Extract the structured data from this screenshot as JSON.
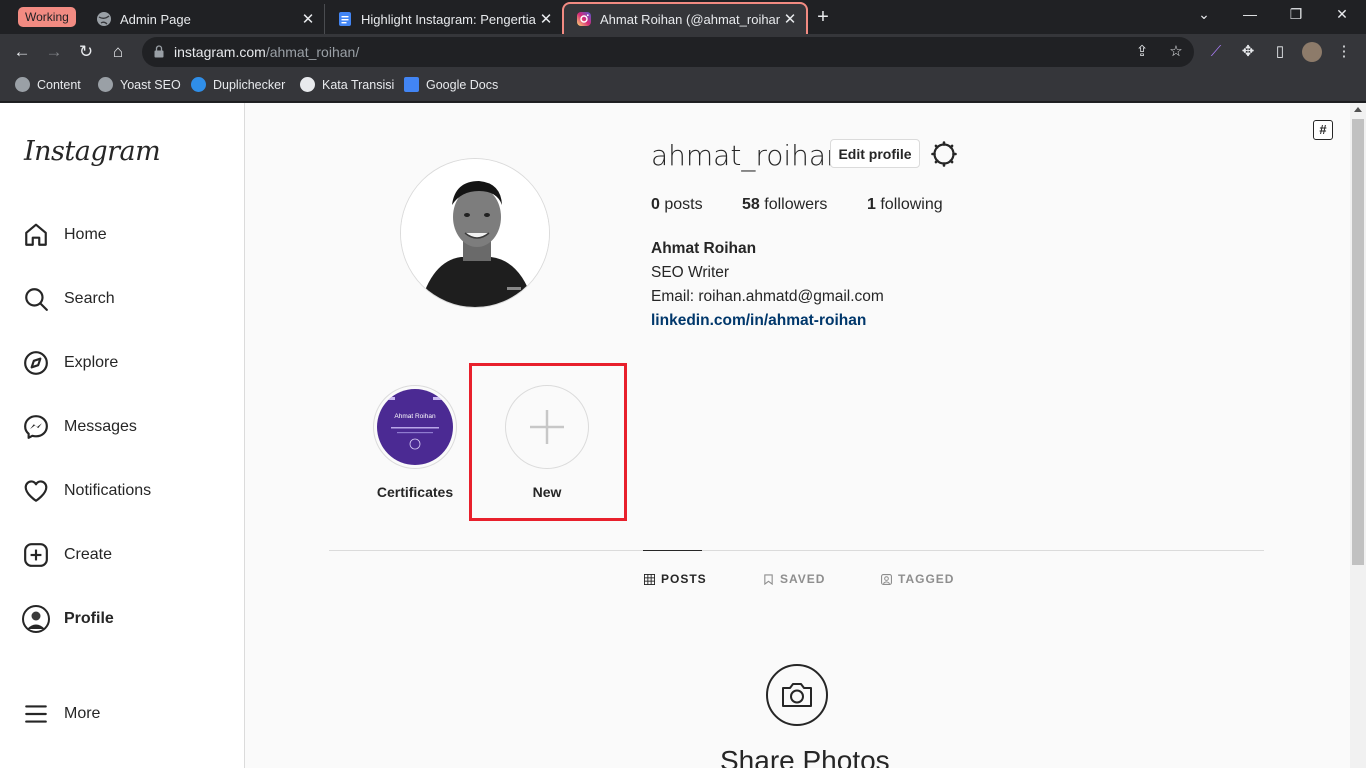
{
  "browser": {
    "tab_group_label": "Working",
    "tabs": [
      {
        "title": "Admin Page"
      },
      {
        "title": "Highlight Instagram: Pengertian, "
      },
      {
        "title": "Ahmat Roihan (@ahmat_roihan) •"
      }
    ],
    "url_host": "instagram.com",
    "url_path": "/ahmat_roihan/",
    "bookmarks": [
      "Content",
      "Yoast SEO",
      "Duplichecker",
      "Kata Transisi",
      "Google Docs"
    ]
  },
  "sidebar": {
    "logo": "Instagram",
    "items": [
      {
        "label": "Home",
        "icon": "home-icon"
      },
      {
        "label": "Search",
        "icon": "search-icon"
      },
      {
        "label": "Explore",
        "icon": "compass-icon"
      },
      {
        "label": "Messages",
        "icon": "messenger-icon"
      },
      {
        "label": "Notifications",
        "icon": "heart-icon"
      },
      {
        "label": "Create",
        "icon": "plus-square-icon"
      },
      {
        "label": "Profile",
        "icon": "avatar-icon"
      },
      {
        "label": "More",
        "icon": "hamburger-icon"
      }
    ]
  },
  "profile": {
    "username": "ahmat_roihan",
    "edit_label": "Edit profile",
    "posts_count": "0",
    "posts_label": "posts",
    "followers_count": "58",
    "followers_label": "followers",
    "following_count": "1",
    "following_label": "following",
    "full_name": "Ahmat Roihan",
    "bio_line1": "SEO Writer",
    "bio_line2": "Email: roihan.ahmatd@gmail.com",
    "link": "linkedin.com/in/ahmat-roihan"
  },
  "highlights": [
    {
      "label": "Certificates"
    },
    {
      "label": "New"
    }
  ],
  "certificate_thumb": {
    "name": "Ahmat Roihan"
  },
  "profile_tabs": [
    "POSTS",
    "SAVED",
    "TAGGED"
  ],
  "empty_state": {
    "title": "Share Photos"
  },
  "colors": {
    "highlight_box": "#e8202c",
    "link": "#00376b"
  }
}
